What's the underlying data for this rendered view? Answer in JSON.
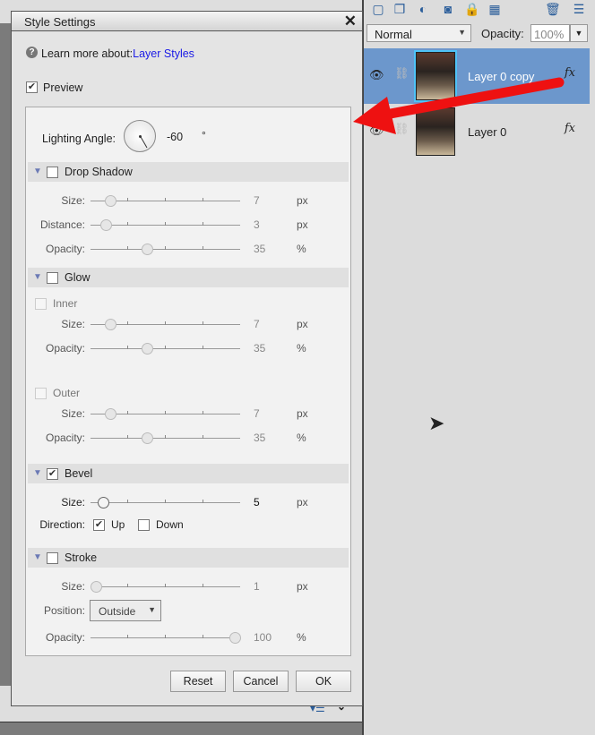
{
  "dialog": {
    "title": "Style Settings",
    "learn_prefix": "Learn more about:",
    "learn_link": "Layer Styles",
    "preview_label": "Preview",
    "preview_checked": true,
    "lighting": {
      "label": "Lighting Angle:",
      "value": "-60",
      "unit": "°"
    },
    "sections": {
      "drop_shadow": {
        "label": "Drop Shadow",
        "checked": false,
        "size": {
          "label": "Size:",
          "value": "7",
          "unit": "px",
          "level": 0.1
        },
        "distance": {
          "label": "Distance:",
          "value": "3",
          "unit": "px",
          "level": 0.07
        },
        "opacity": {
          "label": "Opacity:",
          "value": "35",
          "unit": "%",
          "level": 0.37
        }
      },
      "glow": {
        "label": "Glow",
        "checked": false,
        "inner_label": "Inner",
        "outer_label": "Outer",
        "inner_size": {
          "label": "Size:",
          "value": "7",
          "unit": "px",
          "level": 0.1
        },
        "inner_opacity": {
          "label": "Opacity:",
          "value": "35",
          "unit": "%",
          "level": 0.37
        },
        "outer_size": {
          "label": "Size:",
          "value": "7",
          "unit": "px",
          "level": 0.1
        },
        "outer_opacity": {
          "label": "Opacity:",
          "value": "35",
          "unit": "%",
          "level": 0.37
        }
      },
      "bevel": {
        "label": "Bevel",
        "checked": true,
        "size": {
          "label": "Size:",
          "value": "5",
          "unit": "px",
          "level": 0.05
        },
        "direction_label": "Direction:",
        "up_label": "Up",
        "up_checked": true,
        "down_label": "Down",
        "down_checked": false
      },
      "stroke": {
        "label": "Stroke",
        "checked": false,
        "size": {
          "label": "Size:",
          "value": "1",
          "unit": "px",
          "level": 0.0
        },
        "position_label": "Position:",
        "position_value": "Outside",
        "opacity": {
          "label": "Opacity:",
          "value": "100",
          "unit": "%",
          "level": 1.0
        }
      }
    },
    "buttons": {
      "reset": "Reset",
      "cancel": "Cancel",
      "ok": "OK"
    }
  },
  "layers_panel": {
    "blend_mode": "Normal",
    "opacity_label": "Opacity:",
    "opacity_value": "100%",
    "layers": [
      {
        "name": "Layer 0 copy",
        "selected": true,
        "fx": "fx"
      },
      {
        "name": "Layer 0",
        "selected": false,
        "fx": "fx"
      }
    ]
  },
  "colors": {
    "accent_link": "#1a1ae6",
    "selected_layer": "#6c97cc",
    "annotation_arrow": "#ee1111"
  }
}
